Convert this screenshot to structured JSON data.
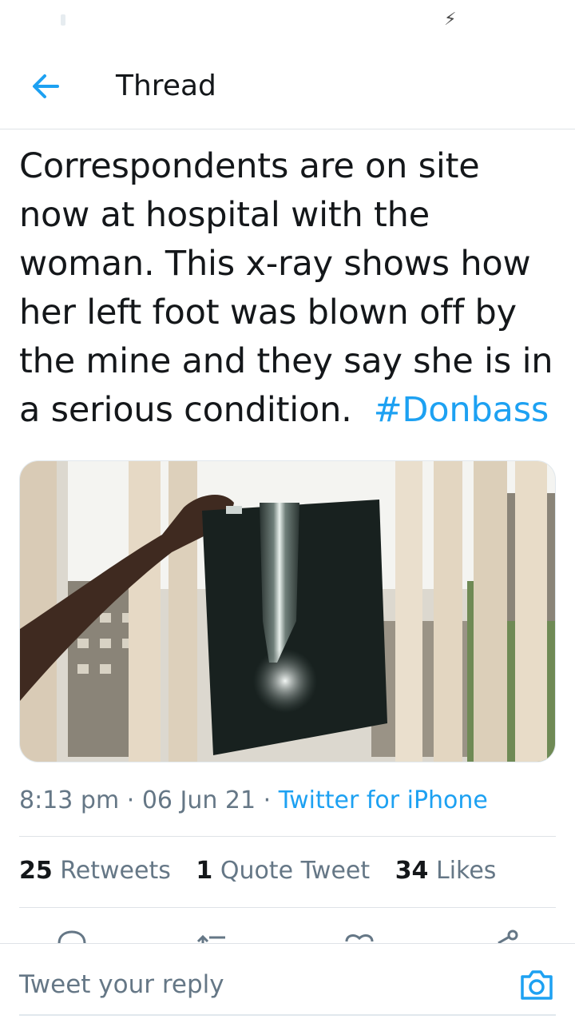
{
  "status_bar": {
    "icons": [
      "signal-icon",
      "charging-bolt-icon"
    ]
  },
  "header": {
    "title": "Thread",
    "back_icon": "arrow-left-icon"
  },
  "tweet": {
    "text_lines": [
      "Correspondents are on site",
      "now at hospital with the",
      "woman.  This x-ray shows how",
      "her left foot was blown off by",
      "the mine and they say she is in",
      "a serious condition."
    ],
    "hashtag": "#Donbass",
    "media": {
      "description_icon": "photo-xray-held-at-window"
    },
    "time": "8:13 pm",
    "separator": "·",
    "date": "06 Jun 21",
    "source": "Twitter for iPhone"
  },
  "stats": {
    "retweets_count": "25",
    "retweets_label": "Retweets",
    "quotes_count": "1",
    "quotes_label": "Quote Tweet",
    "likes_count": "34",
    "likes_label": "Likes"
  },
  "actions": [
    "reply-icon",
    "retweet-icon",
    "like-icon",
    "share-icon"
  ],
  "reply": {
    "placeholder": "Tweet your reply",
    "camera_icon": "camera-icon"
  },
  "colors": {
    "accent": "#1da1f2",
    "text": "#14171a",
    "muted": "#657786",
    "divider": "#dfe3e7"
  }
}
